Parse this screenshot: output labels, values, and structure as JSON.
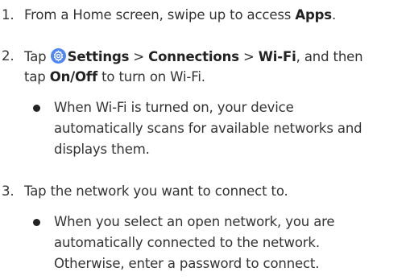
{
  "steps": [
    {
      "number": "1.",
      "lines": [
        {
          "pre": "From a Home screen, swipe up to access ",
          "bold": "Apps",
          "post": "."
        }
      ]
    },
    {
      "number": "2.",
      "line1": {
        "tap": "Tap",
        "icon": "settings-gear-icon",
        "settings": "Settings",
        "sep1": " > ",
        "connections": "Connections",
        "sep2": " > ",
        "wifi": "Wi-Fi",
        "post": ", and then"
      },
      "line2": {
        "pre": "tap ",
        "bold": "On/Off",
        "post": " to turn on Wi-Fi."
      },
      "bullet_lines": [
        "When Wi-Fi is turned on, your device",
        "automatically scans for available networks and",
        "displays them."
      ]
    },
    {
      "number": "3.",
      "text": "Tap the network you want to connect to.",
      "bullet_lines": [
        "When you select an open network, you are",
        "automatically connected to the network.",
        "Otherwise, enter a password to connect."
      ]
    }
  ],
  "colors": {
    "text": "#333333",
    "icon_bg": "#4f86f7"
  }
}
